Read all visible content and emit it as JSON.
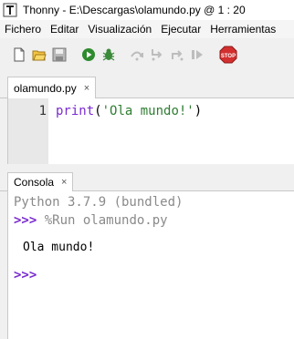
{
  "window": {
    "title": "Thonny  -  E:\\Descargas\\olamundo.py  @  1 : 20",
    "icon": "thonny-app-icon"
  },
  "menu": [
    "Fichero",
    "Editar",
    "Visualización",
    "Ejecutar",
    "Herramientas"
  ],
  "toolbar": {
    "icons": [
      "new-file-icon",
      "open-folder-icon",
      "save-icon",
      "run-icon",
      "debug-icon",
      "step-over-icon",
      "step-into-icon",
      "step-out-icon",
      "resume-icon",
      "stop-icon"
    ],
    "stop_label": "STOP"
  },
  "editor": {
    "tab_label": "olamundo.py",
    "tab_close": "×",
    "line_number": "1",
    "code_function": "print",
    "code_open": "(",
    "code_string": "'Ola mundo!'",
    "code_close": ")"
  },
  "console": {
    "tab_label": "Consola",
    "tab_close": "×",
    "banner": "Python 3.7.9 (bundled)",
    "prompt": ">>>",
    "command": "%Run olamundo.py",
    "output": "Ola mundo!",
    "final_prompt": ">>>"
  },
  "colors": {
    "keyword": "#7a2bd0",
    "string": "#2e7d32",
    "prompt": "#7a2bd0",
    "banner": "#8a8a8a",
    "run": "#2e8b2e",
    "stop": "#d32f2f"
  }
}
